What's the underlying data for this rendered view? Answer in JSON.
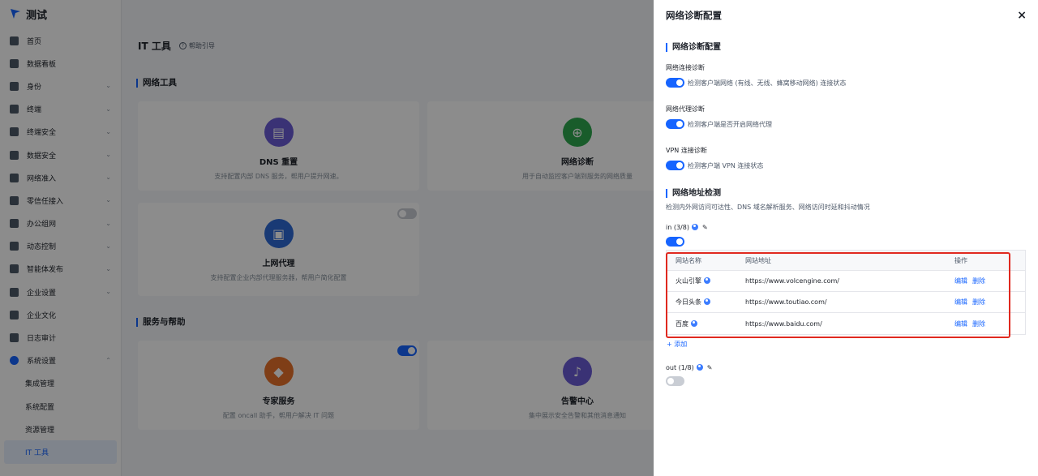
{
  "app": {
    "brand": "测试",
    "page_title": "IT 工具",
    "help": "帮助引导"
  },
  "sidebar": {
    "items": [
      {
        "label": "首页"
      },
      {
        "label": "数据看板"
      },
      {
        "label": "身份"
      },
      {
        "label": "终端"
      },
      {
        "label": "终端安全"
      },
      {
        "label": "数据安全"
      },
      {
        "label": "网络准入"
      },
      {
        "label": "零信任接入"
      },
      {
        "label": "办公组网"
      },
      {
        "label": "动态控制"
      },
      {
        "label": "智能体发布"
      },
      {
        "label": "企业设置"
      },
      {
        "label": "企业文化"
      },
      {
        "label": "日志审计"
      },
      {
        "label": "系统设置"
      }
    ],
    "subitems": [
      {
        "label": "集成管理"
      },
      {
        "label": "系统配置"
      },
      {
        "label": "资源管理"
      },
      {
        "label": "IT 工具"
      }
    ]
  },
  "main": {
    "section_network": "网络工具",
    "section_service": "服务与帮助",
    "cards": [
      {
        "title": "DNS 重置",
        "desc": "支持配置内部 DNS 服务，帮用户提升网速。",
        "color": "#6b5bd6"
      },
      {
        "title": "网络诊断",
        "desc": "用于自动监控客户端到服务的网络质量",
        "color": "#2fa84f"
      },
      {
        "title": "上网代理",
        "desc": "支持配置企业内部代理服务器，帮用户简化配置",
        "color": "#2f6bd6"
      },
      {
        "title": "专家服务",
        "desc": "配置 oncall 助手，帮用户解决 IT 问题",
        "color": "#e8722a"
      },
      {
        "title": "告警中心",
        "desc": "集中展示安全告警和其他消息通知",
        "color": "#6b5bd6"
      }
    ]
  },
  "drawer": {
    "title": "网络诊断配置",
    "close_icon": "×",
    "section1": "网络诊断配置",
    "conn_label": "网络连接诊断",
    "conn_desc": "检测客户端网络 (有线、无线、蜂窝移动网络) 连接状态",
    "proxy_label": "网络代理诊断",
    "proxy_desc": "检测客户端是否开启网络代理",
    "vpn_label": "VPN 连接诊断",
    "vpn_desc": "检测客户端 VPN 连接状态",
    "section2": "网络地址检测",
    "section2_desc": "检测内外网访问可达性、DNS 域名解析服务、网络访问时延和抖动情况",
    "in_label": "in (3/8)",
    "out_label": "out (1/8)",
    "table": {
      "headers": [
        "网站名称",
        "网站地址",
        "操作"
      ],
      "rows": [
        {
          "name": "火山引擎",
          "url": "https://www.volcengine.com/",
          "edit": "编辑",
          "delete": "删除"
        },
        {
          "name": "今日头条",
          "url": "https://www.toutiao.com/",
          "edit": "编辑",
          "delete": "删除"
        },
        {
          "name": "百度",
          "url": "https://www.baidu.com/",
          "edit": "编辑",
          "delete": "删除"
        }
      ]
    },
    "add": "+ 添加"
  }
}
